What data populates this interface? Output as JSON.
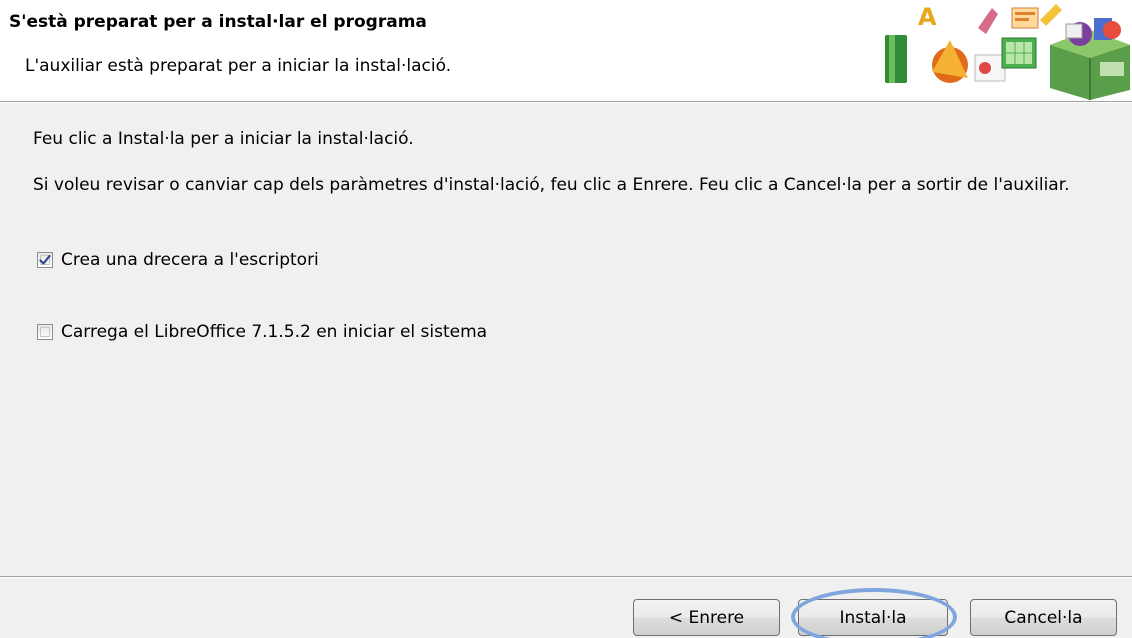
{
  "header": {
    "title": "S'està preparat per a instal·lar el programa",
    "subtitle": "L'auxiliar està preparat per a iniciar la instal·lació."
  },
  "body": {
    "paragraph1": "Feu clic a Instal·la per a iniciar la instal·lació.",
    "paragraph2": "Si voleu revisar o canviar cap dels paràmetres d'instal·lació, feu clic a Enrere. Feu clic a Cancel·la per a sortir de l'auxiliar."
  },
  "options": [
    {
      "label": "Crea una drecera a l'escriptori",
      "checked": true
    },
    {
      "label": "Carrega el LibreOffice 7.1.5.2 en iniciar el sistema",
      "checked": false
    }
  ],
  "buttons": {
    "back": "< Enrere",
    "install": "Instal·la",
    "cancel": "Cancel·la"
  },
  "colors": {
    "highlight_ring": "#7fa5de",
    "check_mark": "#2c4a8c"
  },
  "icons": {
    "header_graphic": "libreoffice-setup-graphic-icon",
    "checked": "checkmark-icon"
  }
}
